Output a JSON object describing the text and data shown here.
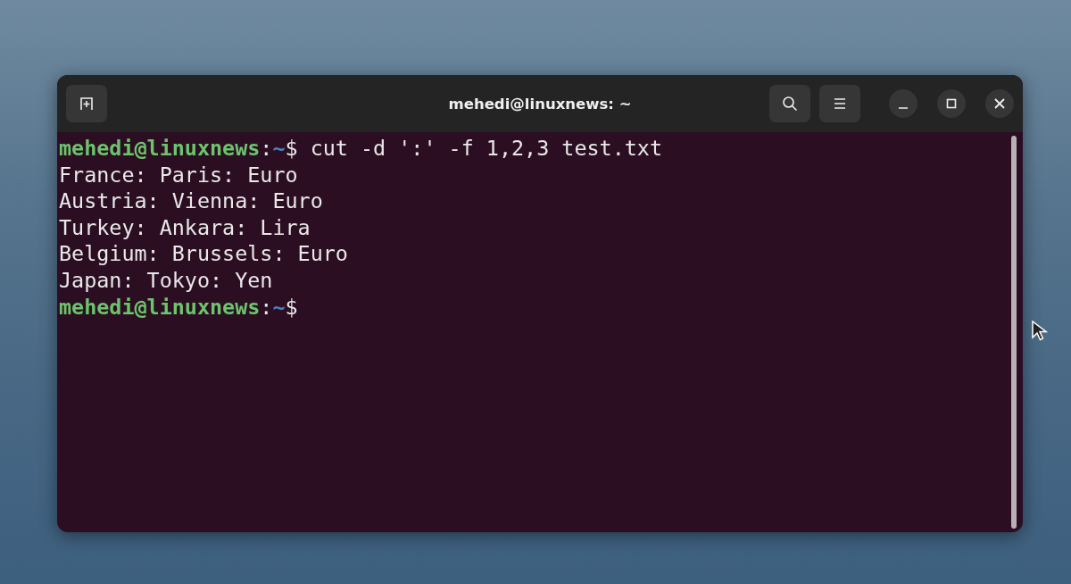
{
  "window": {
    "title": "mehedi@linuxnews: ~"
  },
  "header_left": [
    {
      "kind": "new-tab"
    }
  ],
  "header_right": [
    {
      "kind": "search"
    },
    {
      "kind": "menu"
    },
    {
      "kind": "minimize"
    },
    {
      "kind": "maximize"
    },
    {
      "kind": "close"
    }
  ],
  "terminal": {
    "lines": [
      {
        "kind": "prompt",
        "user_host": "mehedi@linuxnews",
        "separator": ":",
        "path": "~",
        "symbol": "$",
        "command": "cut -d ':' -f 1,2,3 test.txt"
      },
      {
        "kind": "output",
        "text": "France: Paris: Euro"
      },
      {
        "kind": "output",
        "text": "Austria: Vienna: Euro"
      },
      {
        "kind": "output",
        "text": "Turkey: Ankara: Lira"
      },
      {
        "kind": "output",
        "text": "Belgium: Brussels: Euro"
      },
      {
        "kind": "output",
        "text": "Japan: Tokyo: Yen"
      },
      {
        "kind": "prompt",
        "user_host": "mehedi@linuxnews",
        "separator": ":",
        "path": "~",
        "symbol": "$"
      }
    ]
  }
}
